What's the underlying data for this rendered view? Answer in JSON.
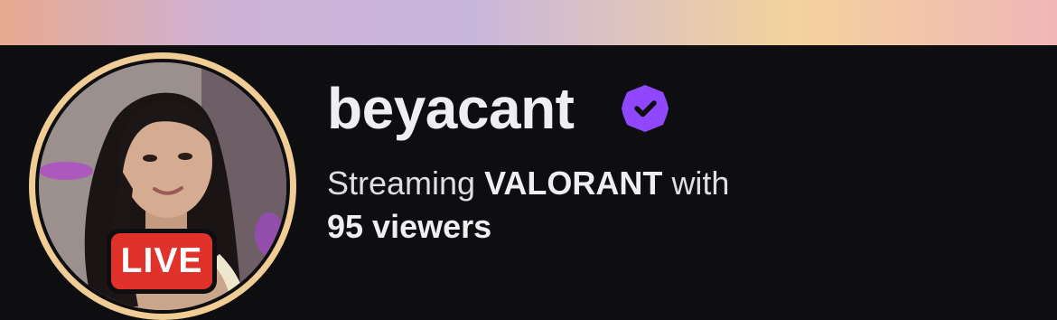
{
  "channel": {
    "name": "beyacant",
    "verified": true,
    "live_label": "LIVE"
  },
  "stream": {
    "prefix": "Streaming",
    "game": "VALORANT",
    "suffix": "with",
    "viewers": "95 viewers"
  },
  "colors": {
    "background": "#0e0e10",
    "live_red": "#e0312b",
    "verified_purple": "#9146ff",
    "avatar_ring": "#f1cd96"
  },
  "icons": {
    "verified": "verified-badge-icon"
  }
}
